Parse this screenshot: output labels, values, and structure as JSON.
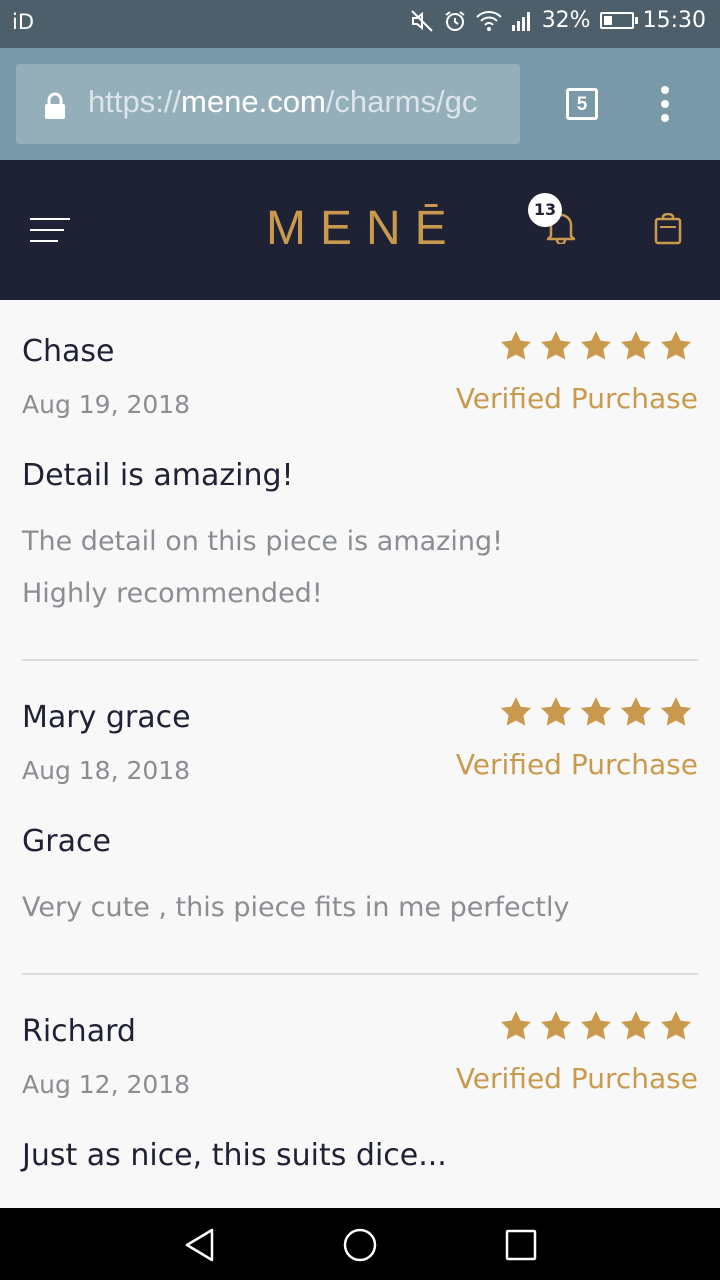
{
  "status_bar": {
    "carrier": "iD",
    "battery_percent": "32%",
    "battery_level": 0.32,
    "time": "15:30",
    "icons": [
      "mute-icon",
      "alarm-icon",
      "wifi-icon",
      "signal-icon",
      "battery-icon"
    ]
  },
  "browser": {
    "url_scheme": "https://",
    "url_host": "mene.com",
    "url_path": "/charms/gc",
    "tab_count": "5"
  },
  "header": {
    "brand": "MENĒ",
    "notification_count": "13",
    "colors": {
      "background": "#1f2234",
      "accent": "#c99a4e"
    }
  },
  "reviews": [
    {
      "name": "Chase",
      "date": "Aug 19, 2018",
      "rating": 5,
      "verified": "Verified Purchase",
      "title": "Detail is amazing!",
      "body": "The detail on this piece is amazing! Highly recommended!"
    },
    {
      "name": "Mary grace",
      "date": "Aug 18, 2018",
      "rating": 5,
      "verified": "Verified Purchase",
      "title": "Grace",
      "body": "Very cute , this piece fits in me perfectly"
    },
    {
      "name": "Richard",
      "date": "Aug 12, 2018",
      "rating": 5,
      "verified": "Verified Purchase",
      "title": "Just as nice, this suits dice...",
      "body": ""
    }
  ],
  "nav_bar": {
    "icons": [
      "back-icon",
      "home-icon",
      "recents-icon"
    ]
  }
}
